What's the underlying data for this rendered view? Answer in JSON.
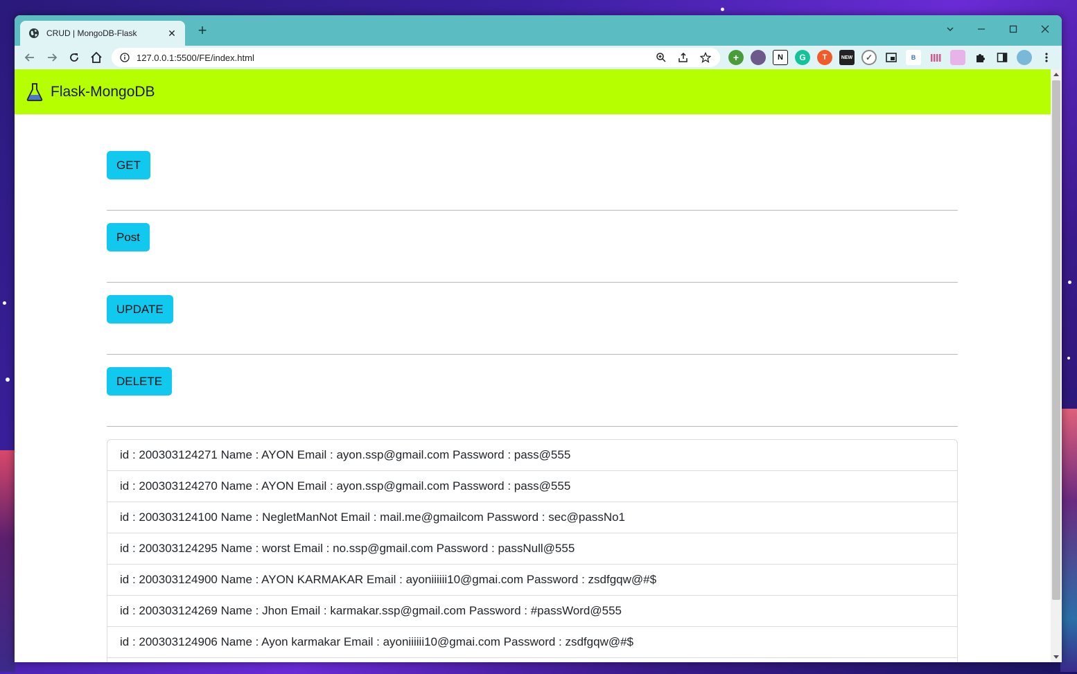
{
  "browser": {
    "tab_title": "CRUD | MongoDB-Flask",
    "tab_close": "✕",
    "new_tab": "+",
    "url": "127.0.0.1:5500/FE/index.html",
    "extension_badges": {
      "bitly": "B"
    }
  },
  "app": {
    "brand": "Flask-MongoDB",
    "brand_color": "#b5ff00",
    "button_color": "#11c9ee"
  },
  "actions": {
    "get_label": "GET",
    "post_label": "Post",
    "update_label": "UPDATE",
    "delete_label": "DELETE"
  },
  "records": [
    "id : 200303124271 Name : AYON Email : ayon.ssp@gmail.com Password : pass@555",
    "id : 200303124270 Name : AYON Email : ayon.ssp@gmail.com Password : pass@555",
    "id : 200303124100 Name : NegletManNot Email : mail.me@gmailcom Password : sec@passNo1",
    "id : 200303124295 Name : worst Email : no.ssp@gmail.com Password : passNull@555",
    "id : 200303124900 Name : AYON KARMAKAR Email : ayoniiiiii10@gmai.com Password : zsdfgqw@#$",
    "id : 200303124269 Name : Jhon Email : karmakar.ssp@gmail.com Password : #passWord@555",
    "id : 200303124906 Name : Ayon karmakar Email : ayoniiiiii10@gmai.com Password : zsdfgqw@#$"
  ]
}
